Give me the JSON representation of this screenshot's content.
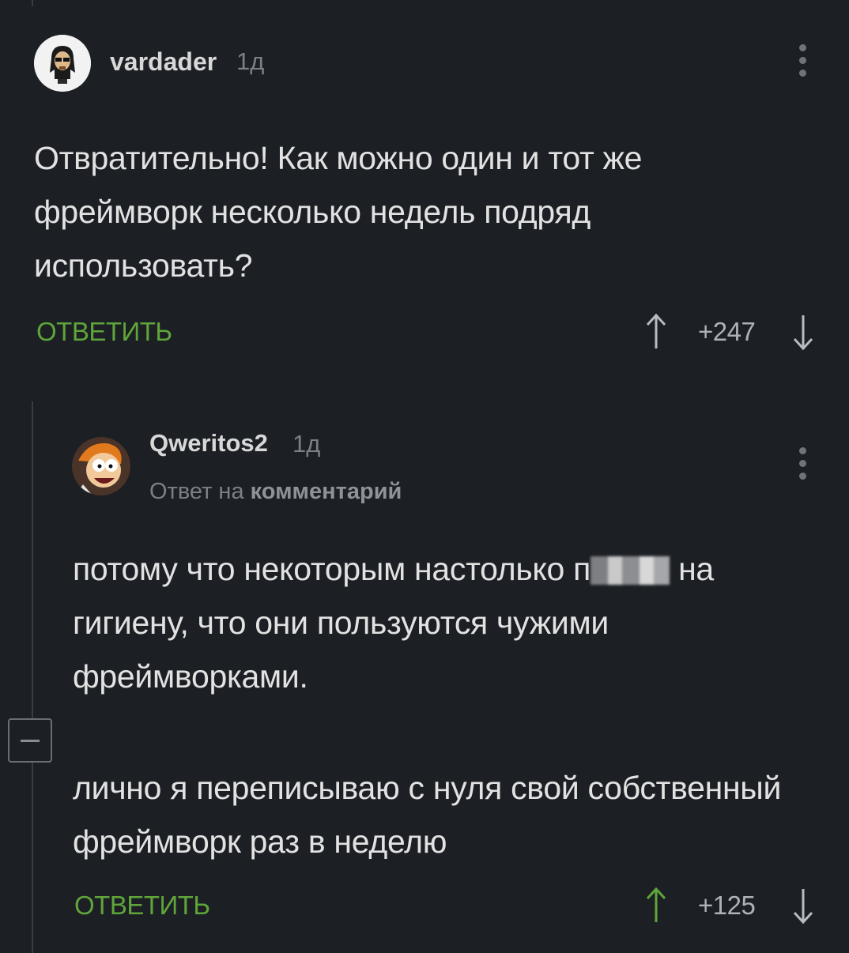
{
  "comment1": {
    "username": "vardader",
    "time": "1д",
    "text": "Отвратительно! Как можно один и тот же фреймворк несколько недель подряд использовать?",
    "reply_label": "ответить",
    "score": "+247"
  },
  "comment2": {
    "username": "Qweritos2",
    "time": "1д",
    "reply_prefix": "Ответ на",
    "reply_target": "комментарий",
    "paragraph1_before": "потому что некоторым настолько п",
    "paragraph1_after": " на гигиену, что они пользуются чужими фреймворками.",
    "paragraph2": "лично я переписываю с нуля свой собственный фреймворк раз в неделю",
    "reply_label": "ответить",
    "score": "+125"
  },
  "colors": {
    "background": "#1c1f24",
    "accent_green": "#5fa53a",
    "text": "#e2e2e2",
    "muted": "#7c8086"
  },
  "icons": [
    "vote-up-icon",
    "vote-down-icon",
    "more-vertical-icon",
    "collapse-icon"
  ]
}
